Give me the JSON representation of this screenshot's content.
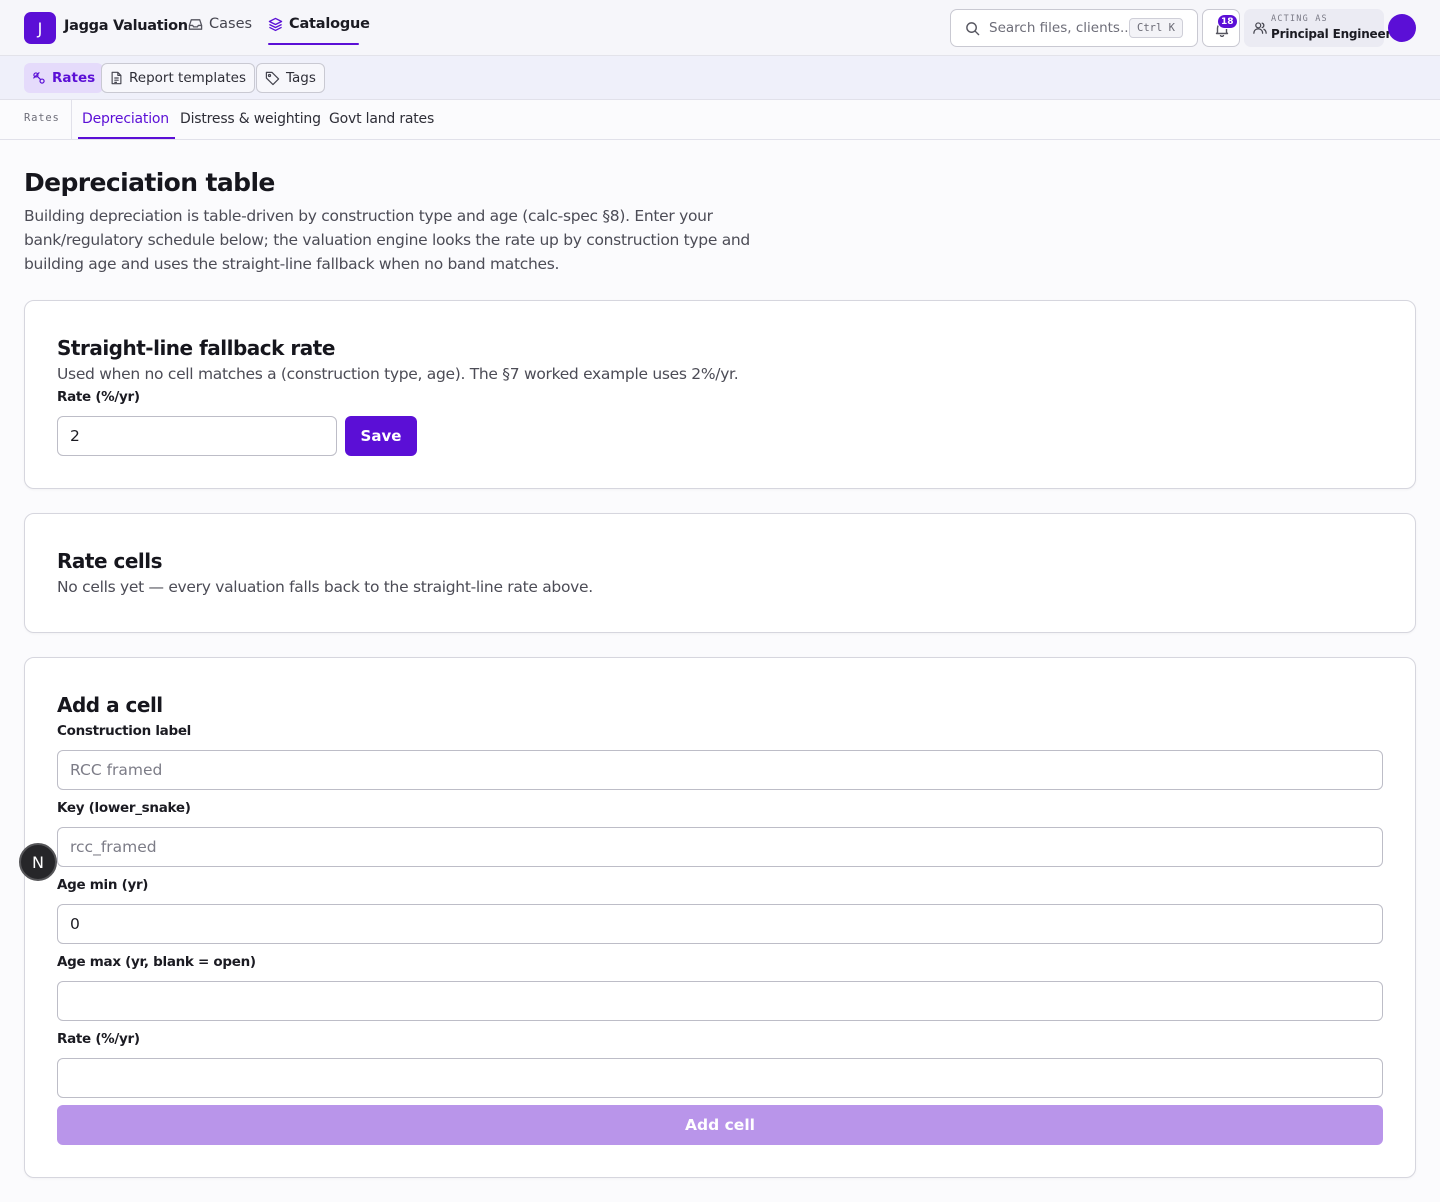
{
  "app": {
    "logo_letter": "J",
    "brand": "Jagga Valuation"
  },
  "topnav": {
    "cases": "Cases",
    "catalogue": "Catalogue"
  },
  "search": {
    "placeholder": "Search files, clients...",
    "shortcut": "Ctrl K"
  },
  "notifications": {
    "count": "18"
  },
  "acting": {
    "label": "ACTING AS",
    "role": "Principal Engineer"
  },
  "subnav": {
    "rates": "Rates",
    "report_templates": "Report templates",
    "tags": "Tags"
  },
  "tabs": {
    "crumb": "Rates",
    "depreciation": "Depreciation",
    "distress": "Distress & weighting",
    "govt": "Govt land rates"
  },
  "page": {
    "title": "Depreciation table",
    "description": "Building depreciation is table-driven by construction type and age (calc-spec §8). Enter your bank/regulatory schedule below; the valuation engine looks the rate up by construction type and building age and uses the straight-line fallback when no band matches."
  },
  "fallback": {
    "title": "Straight-line fallback rate",
    "description": "Used when no cell matches a (construction type, age). The §7 worked example uses 2%/yr.",
    "rate_label": "Rate (%/yr)",
    "rate_value": "2",
    "save_label": "Save"
  },
  "rate_cells": {
    "title": "Rate cells",
    "empty_message": "No cells yet — every valuation falls back to the straight-line rate above."
  },
  "add_cell": {
    "title": "Add a cell",
    "construction_label": "Construction label",
    "construction_placeholder": "RCC framed",
    "key_label": "Key (lower_snake)",
    "key_placeholder": "rcc_framed",
    "age_min_label": "Age min (yr)",
    "age_min_value": "0",
    "age_max_label": "Age max (yr, blank = open)",
    "age_max_value": "",
    "rate_label": "Rate (%/yr)",
    "rate_value": "",
    "button_label": "Add cell"
  },
  "fab": {
    "letter": "N"
  },
  "colors": {
    "accent": "#5b0fd6",
    "accent_disabled": "#b995ea",
    "pill_active_bg": "#e5dbfb"
  }
}
